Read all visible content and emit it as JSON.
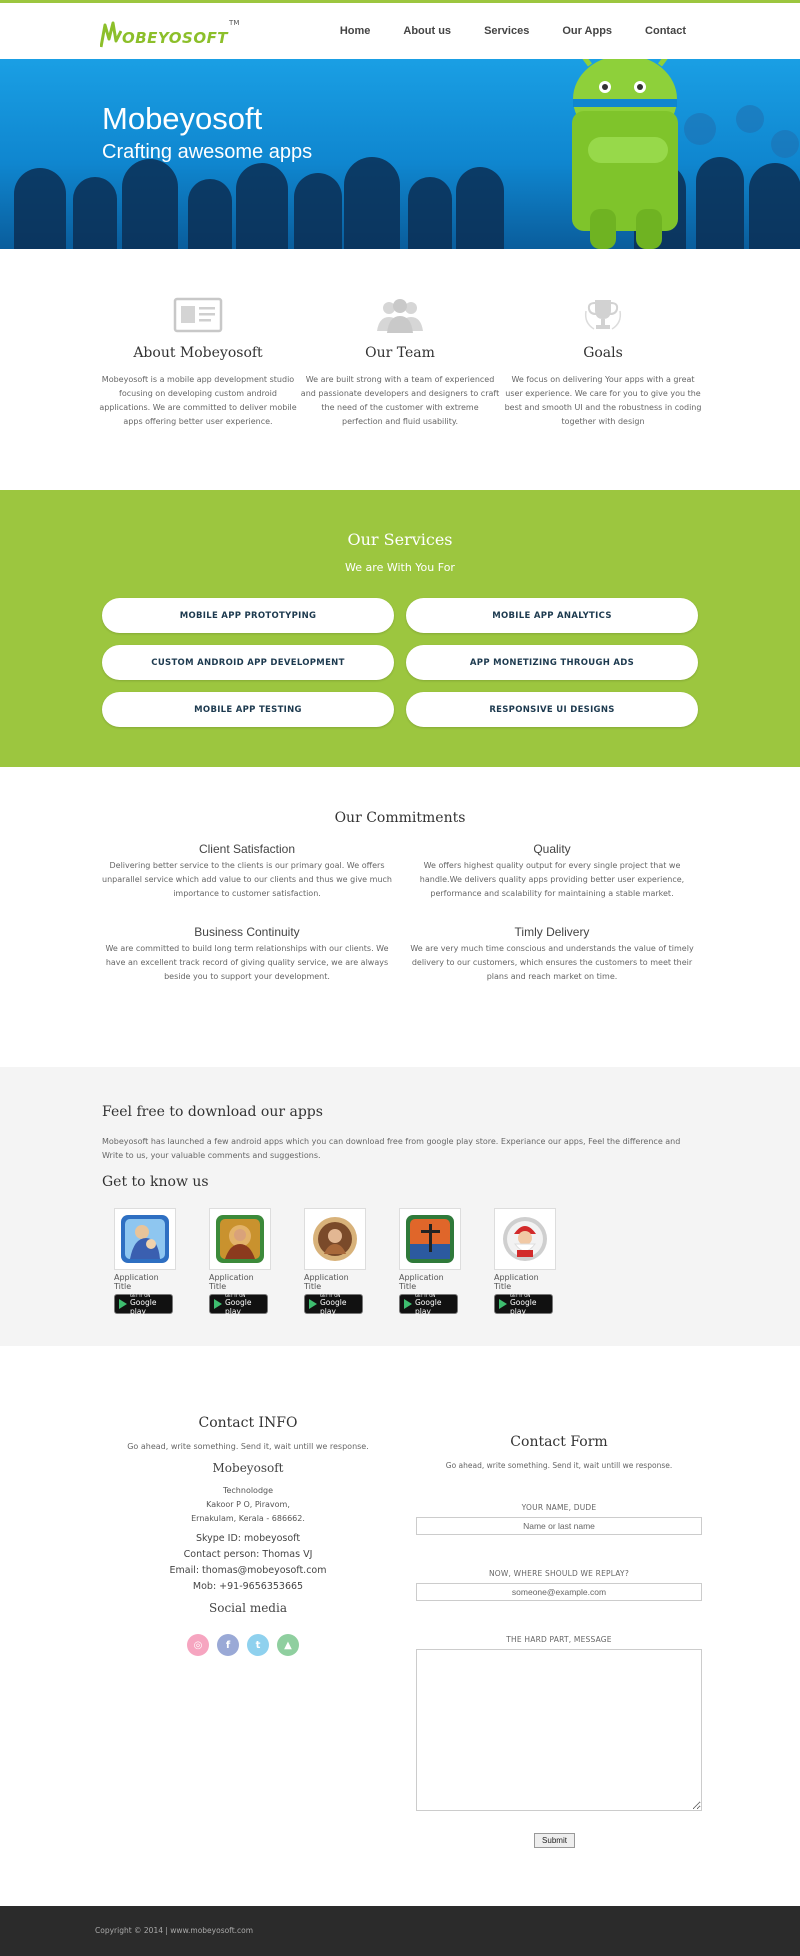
{
  "brand": {
    "logo_text": "OBEYOSOFT",
    "logo_tm": "TM",
    "accent_color": "#9cc63f"
  },
  "nav": {
    "items": [
      "Home",
      "About us",
      "Services",
      "Our Apps",
      "Contact"
    ]
  },
  "hero": {
    "title": "Mobeyosoft",
    "subtitle": "Crafting awesome apps"
  },
  "features": [
    {
      "icon": "id-card-icon",
      "title": "About Mobeyosoft",
      "text": "Mobeyosoft is a mobile app development studio focusing on developing custom android applications. We are committed to deliver mobile apps offering better user experience."
    },
    {
      "icon": "team-icon",
      "title": "Our Team",
      "text": "We are built strong with a team of experienced and passionate developers and designers to craft the need of the customer with extreme perfection and fluid usability."
    },
    {
      "icon": "trophy-icon",
      "title": "Goals",
      "text": "We focus on delivering Your apps with a great user experience. We care for you to give you the best and smooth UI and the robustness in coding together with design"
    }
  ],
  "services": {
    "title": "Our Services",
    "subtitle": "We are With You For",
    "items": [
      "MOBILE APP PROTOTYPING",
      "MOBILE APP ANALYTICS",
      "CUSTOM ANDROID APP DEVELOPMENT",
      "APP MONETIZING THROUGH ADS",
      "MOBILE APP TESTING",
      "RESPONSIVE UI DESIGNS"
    ]
  },
  "commitments": {
    "title": "Our Commitments",
    "items": [
      {
        "title": "Client Satisfaction",
        "text": "Delivering better service to the clients is our primary goal. We offers unparallel service which add value to our clients and thus we give much importance to customer satisfaction."
      },
      {
        "title": "Quality",
        "text": "We offers highest quality output for every single project that we handle.We delivers quality apps providing better user experience, performance and scalability for maintaining a stable market."
      },
      {
        "title": "Business Continuity",
        "text": "We are committed to build long term relationships with our clients. We have an excellent track record of giving quality service, we are always beside you to support your development."
      },
      {
        "title": "Timly Delivery",
        "text": "We are very much time conscious and understands the value of timely delivery to our customers, which ensures the customers to meet their plans and reach market on time."
      }
    ]
  },
  "download": {
    "title": "Feel free to download our apps",
    "text": "Mobeyosoft has launched a few android apps which you can download free from google play store. Experiance our apps, Feel the difference and Write to us, your valuable comments and suggestions.",
    "subtitle": "Get to know us",
    "apps": [
      {
        "title": "Application Title",
        "badge_small": "GET IT ON",
        "badge_big": "Google play"
      },
      {
        "title": "Application Title",
        "badge_small": "GET IT ON",
        "badge_big": "Google play"
      },
      {
        "title": "Application Title",
        "badge_small": "GET IT ON",
        "badge_big": "Google play"
      },
      {
        "title": "Application Title",
        "badge_small": "GET IT ON",
        "badge_big": "Google play"
      },
      {
        "title": "Application Title",
        "badge_small": "GET IT ON",
        "badge_big": "Google play"
      }
    ]
  },
  "contact_info": {
    "title": "Contact INFO",
    "tagline": "Go ahead, write something. Send it, wait untill we response.",
    "company": "Mobeyosoft",
    "address": [
      "Technolodge",
      "Kakoor P O, Piravom,",
      "Ernakulam, Kerala - 686662."
    ],
    "skype": "Skype ID: mobeyosoft",
    "person": "Contact person: Thomas VJ",
    "email": "Email: thomas@mobeyosoft.com",
    "mobile": "Mob: +91-9656353665",
    "social_title": "Social media",
    "social_icons": [
      {
        "name": "dribbble-icon",
        "glyph": "◎",
        "color": "#f6a5c0"
      },
      {
        "name": "facebook-icon",
        "glyph": "f",
        "color": "#9aa9d6"
      },
      {
        "name": "twitter-icon",
        "glyph": "t",
        "color": "#8fd1ee"
      },
      {
        "name": "android-icon",
        "glyph": "▲",
        "color": "#8fcf9f"
      }
    ]
  },
  "contact_form": {
    "title": "Contact Form",
    "tagline": "Go ahead, write something. Send it, wait untill we response.",
    "name_label": "YOUR NAME, DUDE",
    "name_placeholder": "Name or last name",
    "email_label": "NOW, WHERE SHOULD WE REPLAY?",
    "email_placeholder": "someone@example.com",
    "message_label": "THE HARD PART, MESSAGE",
    "submit_label": "Submit"
  },
  "footer": {
    "copyright": "Copyright © 2014 | www.mobeyosoft.com"
  }
}
